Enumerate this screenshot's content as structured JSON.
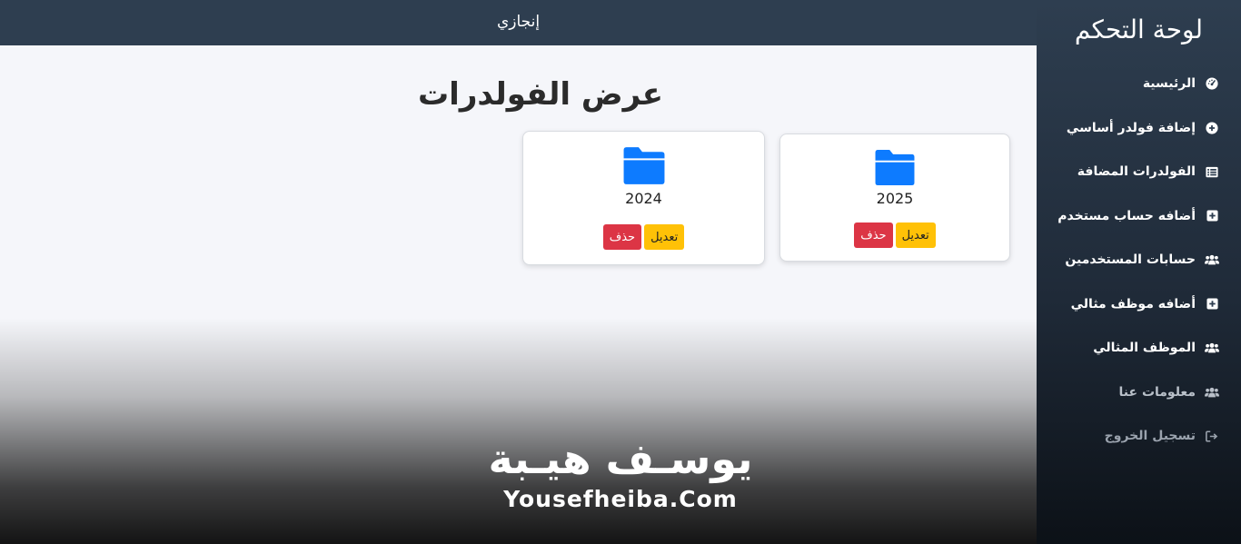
{
  "topbar": {
    "brand": "إنجازي"
  },
  "sidebar": {
    "title": "لوحة التحكم",
    "items": [
      {
        "label": "الرئيسية",
        "icon": "gauge-icon"
      },
      {
        "label": "إضافة فولدر أساسي",
        "icon": "plus-circle-icon"
      },
      {
        "label": "الفولدرات المضافة",
        "icon": "list-icon"
      },
      {
        "label": "أضافه حساب مستخدم",
        "icon": "plus-square-icon"
      },
      {
        "label": "حسابات المستخدمين",
        "icon": "users-icon"
      },
      {
        "label": "أضافه موظف مثالي",
        "icon": "plus-square-icon"
      },
      {
        "label": "الموظف المثالي",
        "icon": "users-icon"
      },
      {
        "label": "معلومات عنا",
        "icon": "users-icon"
      },
      {
        "label": "تسجيل الخروج",
        "icon": "sign-out-icon"
      }
    ]
  },
  "main": {
    "title": "عرض الفولدرات",
    "folders": [
      {
        "year": "2025",
        "edit_label": "تعديل",
        "delete_label": "حذف"
      },
      {
        "year": "2024",
        "edit_label": "تعديل",
        "delete_label": "حذف"
      }
    ]
  },
  "watermark": {
    "arabic": "يوسـف هيـبة",
    "latin": "Yousefheiba.Com"
  },
  "colors": {
    "topbar": "#2e3e50",
    "folder": "#0d7bff",
    "edit": "#ffc107",
    "delete": "#dc3545"
  }
}
